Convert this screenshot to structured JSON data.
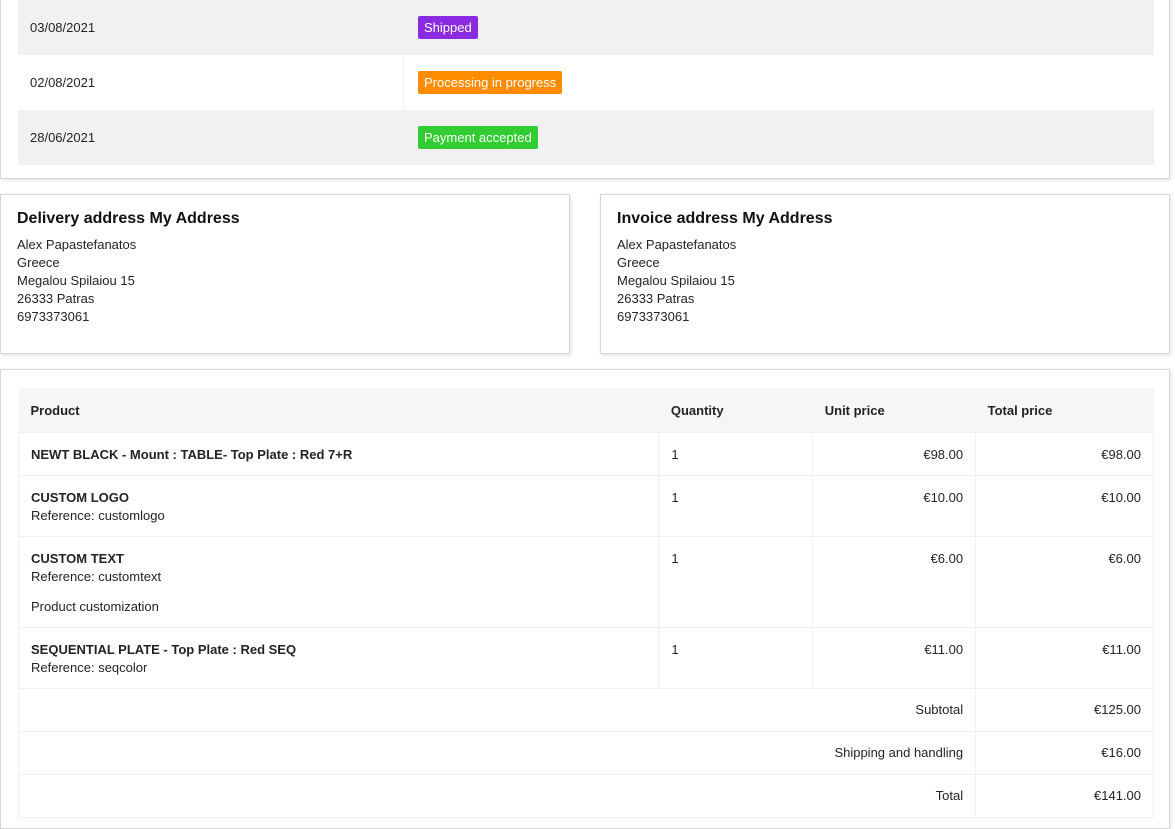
{
  "history": [
    {
      "date": "03/08/2021",
      "status": "Shipped",
      "color": "#8a2be2"
    },
    {
      "date": "02/08/2021",
      "status": "Processing in progress",
      "color": "#ff8c00"
    },
    {
      "date": "28/06/2021",
      "status": "Payment accepted",
      "color": "#32cd32"
    }
  ],
  "delivery": {
    "title": "Delivery address My Address",
    "lines": [
      "Alex Papastefanatos",
      "Greece",
      "Megalou Spilaiou 15",
      "26333 Patras",
      "6973373061"
    ]
  },
  "invoice": {
    "title": "Invoice address My Address",
    "lines": [
      "Alex Papastefanatos",
      "Greece",
      "Megalou Spilaiou 15",
      "26333 Patras",
      "6973373061"
    ]
  },
  "products": {
    "headers": {
      "product": "Product",
      "quantity": "Quantity",
      "unit": "Unit price",
      "total": "Total price"
    },
    "rows": [
      {
        "name": "NEWT BLACK - Mount : TABLE- Top Plate : Red 7+R",
        "reference": "",
        "customization": "",
        "qty": "1",
        "unit": "€98.00",
        "total": "€98.00"
      },
      {
        "name": "CUSTOM LOGO",
        "reference": "Reference: customlogo",
        "customization": "",
        "qty": "1",
        "unit": "€10.00",
        "total": "€10.00"
      },
      {
        "name": "CUSTOM TEXT",
        "reference": "Reference: customtext",
        "customization": "Product customization",
        "qty": "1",
        "unit": "€6.00",
        "total": "€6.00"
      },
      {
        "name": "SEQUENTIAL PLATE - Top Plate : Red SEQ",
        "reference": "Reference: seqcolor",
        "customization": "",
        "qty": "1",
        "unit": "€11.00",
        "total": "€11.00"
      }
    ],
    "summary": [
      {
        "label": "Subtotal",
        "value": "€125.00"
      },
      {
        "label": "Shipping and handling",
        "value": "€16.00"
      },
      {
        "label": "Total",
        "value": "€141.00"
      }
    ]
  }
}
